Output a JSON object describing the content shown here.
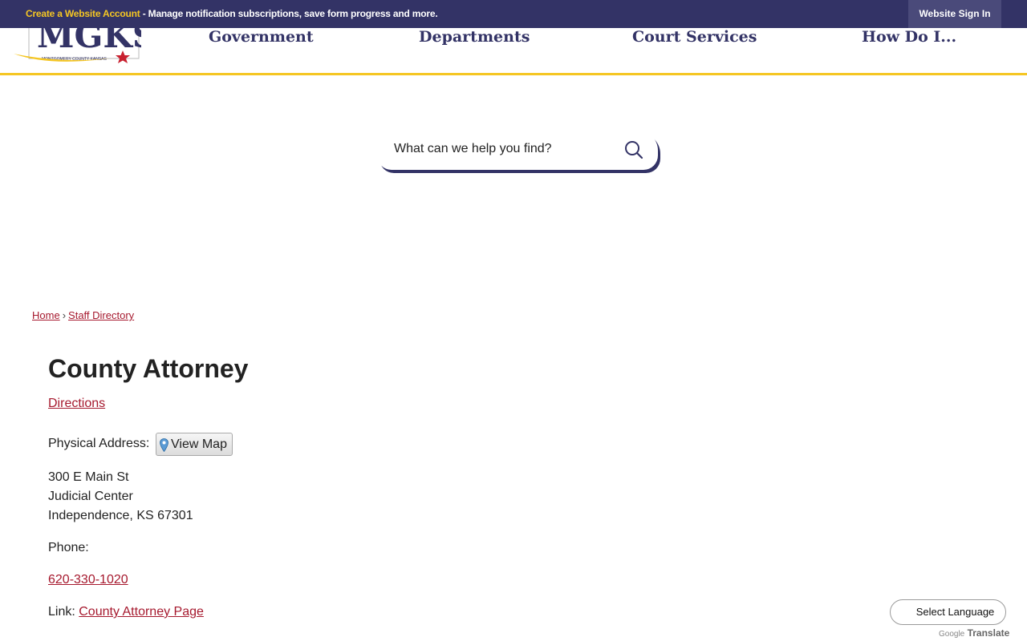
{
  "topbar": {
    "create_account": "Create a Website Account",
    "account_message": " - Manage notification subscriptions, save form progress and more.",
    "sign_in": "Website Sign In"
  },
  "logo": {
    "text": "MGKS",
    "subtext": "MONTGOMERY COUNTY KANSAS"
  },
  "nav": {
    "items": [
      "Government",
      "Departments",
      "Court Services",
      "How Do I..."
    ]
  },
  "search": {
    "placeholder": "What can we help you find?"
  },
  "breadcrumb": {
    "home": "Home",
    "separator": "›",
    "current": "Staff Directory"
  },
  "page": {
    "title": "County Attorney",
    "directions": "Directions",
    "physical_address_label": "Physical Address:",
    "view_map": "View Map",
    "address": [
      "300 E Main St",
      "Judicial Center",
      "Independence, KS 67301"
    ],
    "phone_label": "Phone:",
    "phone": "620-330-1020",
    "link_label": "Link:",
    "link_text": "County Attorney Page"
  },
  "translate": {
    "select_language": "Select Language",
    "google": "Google",
    "translate": "Translate"
  },
  "colors": {
    "navy": "#333366",
    "gold": "#f5c623",
    "link_red": "#a6192e"
  }
}
